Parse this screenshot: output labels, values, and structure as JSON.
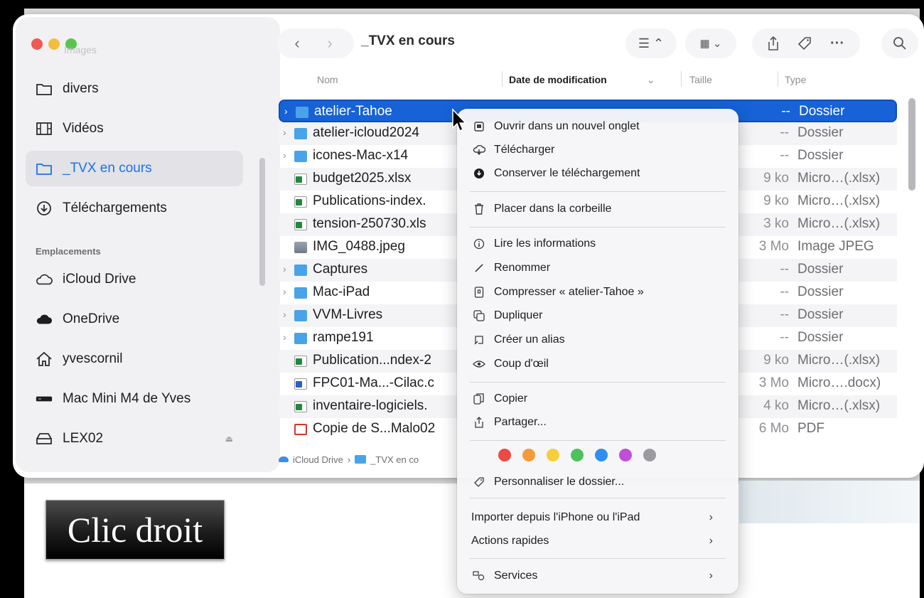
{
  "window": {
    "title": "_TVX en cours",
    "ghost_sidebar_title": "Images"
  },
  "sidebar": {
    "items_top": [
      {
        "label": "divers",
        "icon": "folder-icon"
      },
      {
        "label": "Vidéos",
        "icon": "film-icon"
      },
      {
        "label": "_TVX en cours",
        "icon": "folder-icon",
        "selected": true
      },
      {
        "label": "Téléchargements",
        "icon": "download-icon"
      }
    ],
    "section_label": "Emplacements",
    "locations": [
      {
        "label": "iCloud Drive",
        "icon": "cloud-icon"
      },
      {
        "label": "OneDrive",
        "icon": "cloud-filled-icon"
      },
      {
        "label": "yvescornil",
        "icon": "home-icon"
      },
      {
        "label": "Mac Mini M4 de Yves",
        "icon": "computer-icon"
      },
      {
        "label": "LEX02",
        "icon": "drive-icon"
      }
    ]
  },
  "columns": {
    "name": "Nom",
    "date": "Date de modification",
    "size": "Taille",
    "type": "Type"
  },
  "files": [
    {
      "name": "atelier-Tahoe",
      "size": "--",
      "type": "Dossier",
      "kind": "folder",
      "expandable": true,
      "selected": true
    },
    {
      "name": "atelier-icloud2024",
      "size": "--",
      "type": "Dossier",
      "kind": "folder",
      "expandable": true
    },
    {
      "name": "icones-Mac-x14",
      "size": "--",
      "type": "Dossier",
      "kind": "folder",
      "expandable": true
    },
    {
      "name": "budget2025.xlsx",
      "size": "9 ko",
      "type": "Micro…(.xlsx)",
      "kind": "xls"
    },
    {
      "name": "Publications-index.",
      "size": "9 ko",
      "type": "Micro…(.xlsx)",
      "kind": "xls"
    },
    {
      "name": "tension-250730.xls",
      "size": "3 ko",
      "type": "Micro…(.xlsx)",
      "kind": "xls"
    },
    {
      "name": "IMG_0488.jpeg",
      "size": "3 Mo",
      "type": "Image JPEG",
      "kind": "jpeg"
    },
    {
      "name": "Captures",
      "size": "--",
      "type": "Dossier",
      "kind": "folder",
      "expandable": true
    },
    {
      "name": "Mac-iPad",
      "size": "--",
      "type": "Dossier",
      "kind": "folder",
      "expandable": true
    },
    {
      "name": "VVM-Livres",
      "size": "--",
      "type": "Dossier",
      "kind": "folder",
      "expandable": true
    },
    {
      "name": "rampe191",
      "size": "--",
      "type": "Dossier",
      "kind": "folder",
      "expandable": true
    },
    {
      "name": "Publication...ndex-2",
      "size": "9 ko",
      "type": "Micro…(.xlsx)",
      "kind": "xls"
    },
    {
      "name": "FPC01-Ma...-Cilac.c",
      "size": "3 Mo",
      "type": "Micro….docx)",
      "kind": "docx"
    },
    {
      "name": "inventaire-logiciels.",
      "size": "4 ko",
      "type": "Micro…(.xlsx)",
      "kind": "xls"
    },
    {
      "name": "Copie de S...Malo02",
      "size": "6 Mo",
      "type": "PDF",
      "kind": "pdf"
    }
  ],
  "pathbar": {
    "root": "iCloud Drive",
    "current": "_TVX en co"
  },
  "context_menu": {
    "open_new_tab": "Ouvrir dans un nouvel onglet",
    "download": "Télécharger",
    "keep_download": "Conserver le téléchargement",
    "trash": "Placer dans la corbeille",
    "get_info": "Lire les informations",
    "rename": "Renommer",
    "compress": "Compresser « atelier-Tahoe »",
    "duplicate": "Dupliquer",
    "make_alias": "Créer un alias",
    "quick_look": "Coup d'œil",
    "copy": "Copier",
    "share": "Partager...",
    "tag_colors": [
      "#ec4a45",
      "#f39b3a",
      "#f5cf3a",
      "#4cc35a",
      "#2f8ff0",
      "#c04fd8",
      "#9a9aa0"
    ],
    "customize_folder": "Personnaliser le dossier...",
    "import_iphone": "Importer depuis l'iPhone ou l'iPad",
    "quick_actions": "Actions rapides",
    "services": "Services"
  },
  "overlay": {
    "caption": "Clic droit"
  }
}
